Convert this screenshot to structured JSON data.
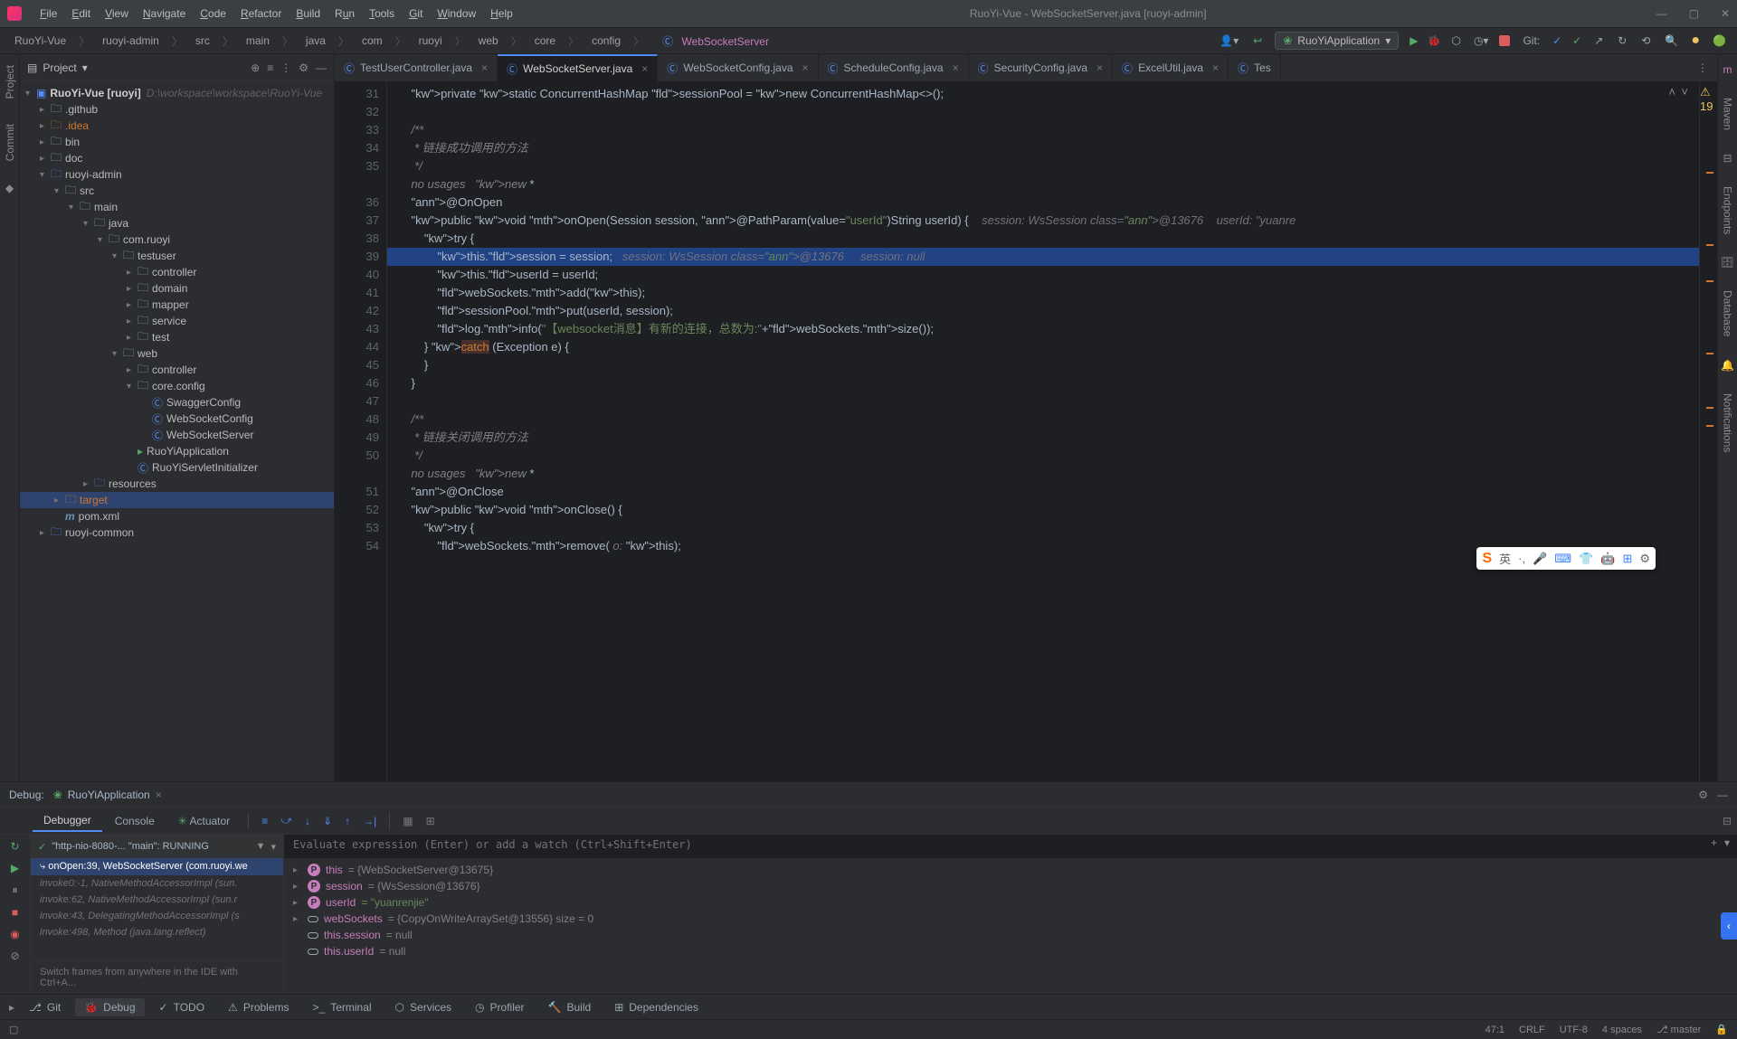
{
  "title": "RuoYi-Vue - WebSocketServer.java [ruoyi-admin]",
  "menu": [
    "File",
    "Edit",
    "View",
    "Navigate",
    "Code",
    "Refactor",
    "Build",
    "Run",
    "Tools",
    "Git",
    "Window",
    "Help"
  ],
  "crumbs": [
    "RuoYi-Vue",
    "ruoyi-admin",
    "src",
    "main",
    "java",
    "com",
    "ruoyi",
    "web",
    "core",
    "config",
    "WebSocketServer"
  ],
  "runconfig": "RuoYiApplication",
  "git_label": "Git:",
  "project": {
    "label": "Project",
    "root": "RuoYi-Vue [ruoyi]",
    "root_path": "D:\\workspace\\workspace\\RuoYi-Vue",
    "items": [
      {
        "t": ".github",
        "d": 1,
        "a": "r",
        "f": 1
      },
      {
        "t": ".idea",
        "d": 1,
        "a": "r",
        "f": 1,
        "exc": 1
      },
      {
        "t": "bin",
        "d": 1,
        "a": "r",
        "f": 1
      },
      {
        "t": "doc",
        "d": 1,
        "a": "r",
        "f": 1
      },
      {
        "t": "ruoyi-admin",
        "d": 1,
        "a": "d",
        "f": 1,
        "mod": 1
      },
      {
        "t": "src",
        "d": 2,
        "a": "d",
        "f": 1
      },
      {
        "t": "main",
        "d": 3,
        "a": "d",
        "f": 1
      },
      {
        "t": "java",
        "d": 4,
        "a": "d",
        "f": 1
      },
      {
        "t": "com.ruoyi",
        "d": 5,
        "a": "d",
        "f": 1
      },
      {
        "t": "testuser",
        "d": 6,
        "a": "d",
        "f": 1
      },
      {
        "t": "controller",
        "d": 7,
        "a": "r",
        "f": 1
      },
      {
        "t": "domain",
        "d": 7,
        "a": "r",
        "f": 1
      },
      {
        "t": "mapper",
        "d": 7,
        "a": "r",
        "f": 1
      },
      {
        "t": "service",
        "d": 7,
        "a": "r",
        "f": 1
      },
      {
        "t": "test",
        "d": 7,
        "a": "r",
        "f": 1
      },
      {
        "t": "web",
        "d": 6,
        "a": "d",
        "f": 1
      },
      {
        "t": "controller",
        "d": 7,
        "a": "r",
        "f": 1
      },
      {
        "t": "core.config",
        "d": 7,
        "a": "d",
        "f": 1
      },
      {
        "t": "SwaggerConfig",
        "d": 8,
        "c": 1
      },
      {
        "t": "WebSocketConfig",
        "d": 8,
        "c": 1
      },
      {
        "t": "WebSocketServer",
        "d": 8,
        "c": 1
      },
      {
        "t": "RuoYiApplication",
        "d": 7,
        "c": 1,
        "run": 1
      },
      {
        "t": "RuoYiServletInitializer",
        "d": 7,
        "c": 1
      },
      {
        "t": "resources",
        "d": 4,
        "a": "r",
        "f": 1,
        "mod": 1
      },
      {
        "t": "target",
        "d": 2,
        "a": "r",
        "f": 1,
        "exc": 1,
        "sel": 1
      },
      {
        "t": "pom.xml",
        "d": 2,
        "pom": 1
      },
      {
        "t": "ruoyi-common",
        "d": 1,
        "a": "r",
        "f": 1,
        "mod": 1
      }
    ]
  },
  "tabs": [
    {
      "n": "TestUserController.java",
      "c": 1
    },
    {
      "n": "WebSocketServer.java",
      "c": 1,
      "active": 1
    },
    {
      "n": "WebSocketConfig.java",
      "c": 1
    },
    {
      "n": "ScheduleConfig.java",
      "c": 1
    },
    {
      "n": "SecurityConfig.java",
      "c": 1
    },
    {
      "n": "ExcelUtil.java",
      "c": 1
    },
    {
      "n": "Tes",
      "short": 1
    }
  ],
  "warnings": "19",
  "code_start": 31,
  "code": [
    "    private static ConcurrentHashMap<String,Session> sessionPool = new ConcurrentHashMap<>();",
    "",
    "    /**",
    "     * 链接成功调用的方法",
    "     */",
    "    no usages   new *",
    "    @OnOpen",
    "    public void onOpen(Session session, @PathParam(value=\"userId\")String userId) {    session: WsSession@13676    userId: \"yuanre",
    "        try {",
    "            this.session = session;   session: WsSession@13676     session: null",
    "            this.userId = userId;",
    "            webSockets.add(this);",
    "            sessionPool.put(userId, session);",
    "            log.info(\"【websocket消息】有新的连接，总数为:\"+webSockets.size());",
    "        } catch (Exception e) {",
    "        }",
    "    }",
    "",
    "    /**",
    "     * 链接关闭调用的方法",
    "     */",
    "    no usages   new *",
    "    @OnClose",
    "    public void onClose() {",
    "        try {",
    "            webSockets.remove( o: this);"
  ],
  "breakpoint_line": 39,
  "highlight_line": 39,
  "debug": {
    "title": "Debug:",
    "config": "RuoYiApplication",
    "tabs": [
      "Debugger",
      "Console",
      "Actuator"
    ],
    "thread": "\"http-nio-8080-... \"main\": RUNNING",
    "frames": [
      {
        "t": "onOpen:39, WebSocketServer (com.ruoyi.we",
        "sel": 1
      },
      {
        "t": "invoke0:-1, NativeMethodAccessorImpl (sun.",
        "dim": 1
      },
      {
        "t": "invoke:62, NativeMethodAccessorImpl (sun.r",
        "dim": 1
      },
      {
        "t": "invoke:43, DelegatingMethodAccessorImpl (s",
        "dim": 1
      },
      {
        "t": "invoke:498, Method (java.lang.reflect)",
        "dim": 1
      }
    ],
    "frames_hint": "Switch frames from anywhere in the IDE with Ctrl+A...",
    "eval_placeholder": "Evaluate expression (Enter) or add a watch (Ctrl+Shift+Enter)",
    "vars": [
      {
        "k": "p",
        "n": "this",
        "v": "= {WebSocketServer@13675}"
      },
      {
        "k": "p",
        "n": "session",
        "v": "= {WsSession@13676}"
      },
      {
        "k": "p",
        "n": "userId",
        "v": "= \"yuanrenjie\"",
        "str": 1
      },
      {
        "k": "o",
        "n": "webSockets",
        "v": "= {CopyOnWriteArraySet@13556}  size = 0"
      },
      {
        "k": "o",
        "n": "this.session",
        "v": "= null"
      },
      {
        "k": "o",
        "n": "this.userId",
        "v": "= null"
      }
    ]
  },
  "toolwins": [
    {
      "n": "Git",
      "i": "⎇"
    },
    {
      "n": "Debug",
      "i": "🐞",
      "a": 1
    },
    {
      "n": "TODO",
      "i": "✓"
    },
    {
      "n": "Problems",
      "i": "⚠"
    },
    {
      "n": "Terminal",
      "i": ">_"
    },
    {
      "n": "Services",
      "i": "⬡"
    },
    {
      "n": "Profiler",
      "i": "◷"
    },
    {
      "n": "Build",
      "i": "🔨"
    },
    {
      "n": "Dependencies",
      "i": "⊞"
    }
  ],
  "status": {
    "pos": "47:1",
    "le": "CRLF",
    "enc": "UTF-8",
    "indent": "4 spaces",
    "branch": "master"
  }
}
